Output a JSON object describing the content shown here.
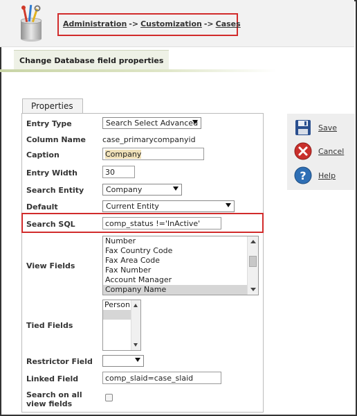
{
  "breadcrumb": {
    "items": [
      "Administration",
      "Customization",
      "Cases"
    ],
    "separator": "->"
  },
  "page_title": "Change Database field properties",
  "properties_tab": "Properties",
  "fields": {
    "entry_type": {
      "label": "Entry Type",
      "value": "Search Select Advanced"
    },
    "column_name": {
      "label": "Column Name",
      "value": "case_primarycompanyid"
    },
    "caption": {
      "label": "Caption",
      "value": "Company"
    },
    "entry_width": {
      "label": "Entry Width",
      "value": "30"
    },
    "search_entity": {
      "label": "Search Entity",
      "value": "Company"
    },
    "default": {
      "label": "Default",
      "value": "Current Entity"
    },
    "search_sql": {
      "label": "Search SQL",
      "value": "comp_status !='InActive'"
    },
    "view_fields": {
      "label": "View Fields",
      "options": [
        "Number",
        "Fax Country Code",
        "Fax Area Code",
        "Fax Number",
        "Account Manager",
        "Company Name"
      ],
      "selected": "Company Name"
    },
    "tied_fields": {
      "label": "Tied Fields",
      "options": [
        "Person",
        ""
      ]
    },
    "restrictor_field": {
      "label": "Restrictor Field",
      "value": ""
    },
    "linked_field": {
      "label": "Linked Field",
      "value": "comp_slaid=case_slaid"
    },
    "search_all_view": {
      "label": "Search on all view fields",
      "checked": false
    }
  },
  "actions": {
    "save": "Save",
    "cancel": "Cancel",
    "help": "Help"
  },
  "colors": {
    "highlight_border": "#d12b2b",
    "caption_highlight": "#efe0b8",
    "save_icon": "#2a4f8f",
    "cancel_icon": "#c9302c",
    "help_icon": "#2f6fb5"
  }
}
